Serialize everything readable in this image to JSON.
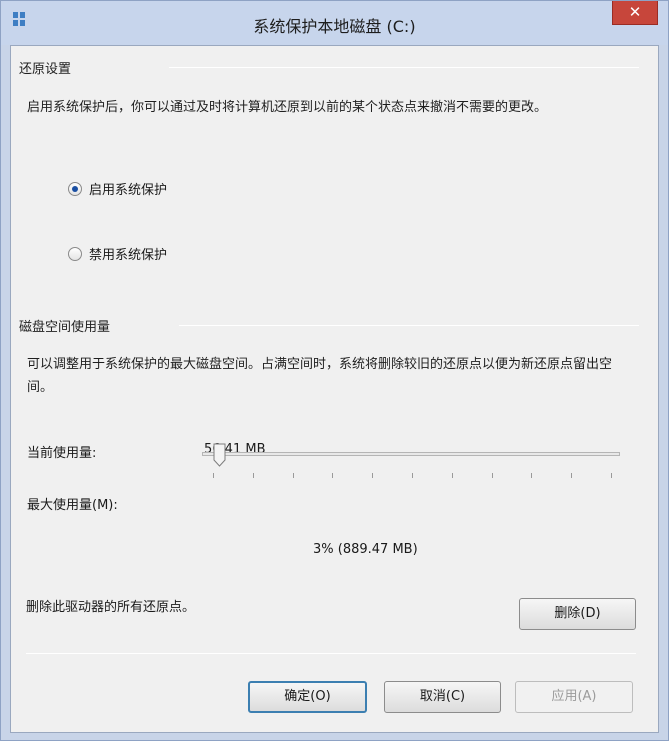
{
  "window": {
    "title": "系统保护本地磁盘 (C:)",
    "close_glyph": "✕",
    "icon": "app-icon"
  },
  "restore_settings": {
    "group_title": "还原设置",
    "description": "启用系统保护后，你可以通过及时将计算机还原到以前的某个状态点来撤消不需要的更改。",
    "options": [
      {
        "label": "启用系统保护",
        "checked": true
      },
      {
        "label": "禁用系统保护",
        "checked": false
      }
    ]
  },
  "disk_usage": {
    "group_title": "磁盘空间使用量",
    "description": "可以调整用于系统保护的最大磁盘空间。占满空间时，系统将删除较旧的还原点以便为新还原点留出空间。",
    "current_label": "当前使用量:",
    "current_value": "56.41 MB",
    "max_label": "最大使用量(M):",
    "max_percent": 3,
    "max_readout": "3% (889.47 MB)",
    "delete_text": "删除此驱动器的所有还原点。",
    "delete_button": "删除(D)"
  },
  "footer": {
    "ok": "确定(O)",
    "cancel": "取消(C)",
    "apply": "应用(A)"
  },
  "colors": {
    "accent": "#3c7fb1",
    "close": "#c7463b",
    "titlebar": "#c7d5ec"
  }
}
